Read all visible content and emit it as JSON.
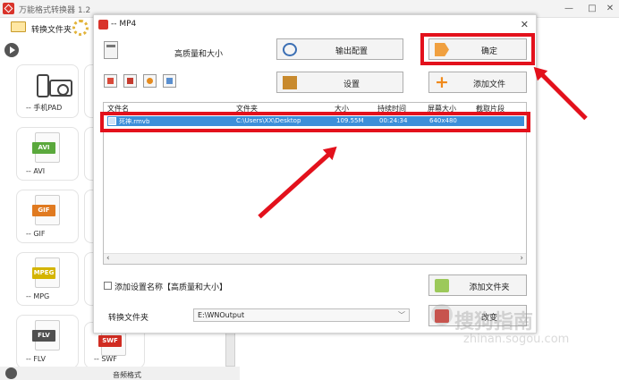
{
  "app": {
    "title": "万能格式转换器 1.2"
  },
  "toolbar": {
    "convert_folder": "转换文件夹"
  },
  "formats": [
    {
      "label": "-- 手机PAD"
    },
    {
      "label": "-- AVI",
      "tag": "AVI",
      "color": "#5aa83c"
    },
    {
      "label": "-- GIF",
      "tag": "GIF",
      "color": "#e07a20"
    },
    {
      "label": "-- MPG",
      "tag": "MPEG",
      "color": "#d4b400"
    },
    {
      "label": "-- FLV",
      "tag": "FLV",
      "color": "#505050"
    },
    {
      "label": "-- SWF",
      "tag": "SWF",
      "color": "#d02c22"
    }
  ],
  "audio_label": "音频格式",
  "dialog": {
    "title": "-- MP4",
    "profile_name": "高质量和大小",
    "buttons": {
      "output_config": "输出配置",
      "ok": "确定",
      "settings": "设置",
      "add_file": "添加文件",
      "add_folder": "添加文件夹",
      "change": "改变"
    },
    "columns": [
      "文件名",
      "文件夹",
      "大小",
      "持续时间",
      "屏幕大小",
      "截取片段"
    ],
    "rows": [
      {
        "name": "死神.rmvb",
        "folder": "C:\\Users\\XX\\Desktop",
        "size": "109.55M",
        "duration": "00:24:34",
        "screen": "640x480",
        "clip": ""
      }
    ],
    "add_setting_label": "添加设置名称【高质量和大小】",
    "output_folder_label": "转换文件夹",
    "output_folder_value": "E:\\WNOutput"
  },
  "watermark": {
    "main": "搜狗指南",
    "sub": "zhinan.sogou.com"
  },
  "colors": {
    "highlight": "#e3111c",
    "selection": "#3d8fd9",
    "brand": "#d9342b"
  }
}
